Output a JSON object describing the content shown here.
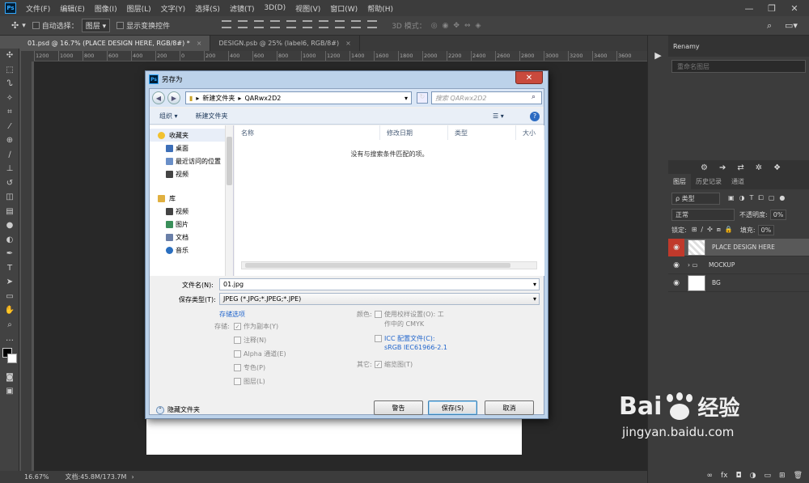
{
  "menu": {
    "items": [
      "文件(F)",
      "编辑(E)",
      "图像(I)",
      "图层(L)",
      "文字(Y)",
      "选择(S)",
      "滤镜(T)",
      "3D(D)",
      "视图(V)",
      "窗口(W)",
      "帮助(H)"
    ]
  },
  "options_bar": {
    "auto_select_label": "自动选择：",
    "auto_select_value": "图层",
    "transform_label": "显示变换控件",
    "mode_3d_label": "3D 模式："
  },
  "tabs": [
    {
      "label": "01.psd @ 16.7% (PLACE DESIGN HERE, RGB/8#) *"
    },
    {
      "label": "DESIGN.psb @ 25% (label6, RGB/8#)"
    }
  ],
  "ruler": {
    "ticks": [
      "1200",
      "1000",
      "800",
      "600",
      "400",
      "200",
      "0",
      "200",
      "400",
      "600",
      "800",
      "1000",
      "1200",
      "1400",
      "1600",
      "1800",
      "2000",
      "2200",
      "2400",
      "2600",
      "2800",
      "3000",
      "3200",
      "3400",
      "3600",
      "3800",
      "4000",
      "4200",
      "4400",
      "4600",
      "4800"
    ]
  },
  "status": {
    "zoom": "16.67%",
    "doc": "文档:45.8M/173.7M"
  },
  "dialog": {
    "title": "另存为",
    "path": [
      "新建文件夹",
      "QARwx2D2"
    ],
    "search_placeholder": "搜索 QARwx2D2",
    "organize": "组织 ▾",
    "new_folder": "新建文件夹",
    "nav_items": [
      {
        "label": "收藏夹",
        "color": "#f2c12e"
      },
      {
        "label": "桌面",
        "color": "#3d6fb8"
      },
      {
        "label": "最近访问的位置",
        "color": "#6a8fc8"
      },
      {
        "label": "视频",
        "color": "#444"
      },
      {
        "label": "库",
        "color": "#e0b040"
      },
      {
        "label": "视频",
        "color": "#444"
      },
      {
        "label": "图片",
        "color": "#3a8f5a"
      },
      {
        "label": "文档",
        "color": "#6a7fa8"
      },
      {
        "label": "音乐",
        "color": "#2a6fc0"
      }
    ],
    "columns": {
      "name": "名称",
      "date": "修改日期",
      "type": "类型",
      "size": "大小"
    },
    "empty_msg": "没有与搜索条件匹配的项。",
    "filename_label": "文件名(N):",
    "filename_value": "01.jpg",
    "filetype_label": "保存类型(T):",
    "filetype_value": "JPEG (*.JPG;*.JPEG;*.JPE)",
    "save_options_link": "存储选项",
    "save_label": "存储:",
    "opt_copy": "作为副本(Y)",
    "opt_notes": "注释(N)",
    "opt_alpha": "Alpha 通道(E)",
    "opt_spot": "专色(P)",
    "opt_layers": "图层(L)",
    "color_label": "颜色:",
    "opt_proof": "使用校样设置(O): 工",
    "opt_proof2": "作中的 CMYK",
    "opt_icc": "ICC 配置文件(C):",
    "opt_icc2": "sRGB IEC61966-2.1",
    "other_label": "其它:",
    "opt_thumb": "缩览图(T)",
    "hide_folders": "隐藏文件夹",
    "warn_btn": "警告",
    "save_btn": "保存(S)",
    "cancel_btn": "取消"
  },
  "panels": {
    "renamy_tab": "Renamy",
    "renamy_placeholder": "重命名图层",
    "layer_tabs": [
      "图层",
      "历史记录",
      "通道"
    ],
    "filter_label": "ρ 类型",
    "blend_mode": "正常",
    "opacity_label": "不透明度:",
    "opacity_value": "0%",
    "lock_label": "锁定:",
    "fill_label": "填充:",
    "fill_value": "0%",
    "layers": [
      {
        "name": "PLACE DESIGN HERE"
      },
      {
        "name": "MOCKUP"
      },
      {
        "name": "BG"
      }
    ]
  },
  "watermark": {
    "brand": "Bai",
    "brand2": "经验",
    "url": "jingyan.baidu.com"
  }
}
